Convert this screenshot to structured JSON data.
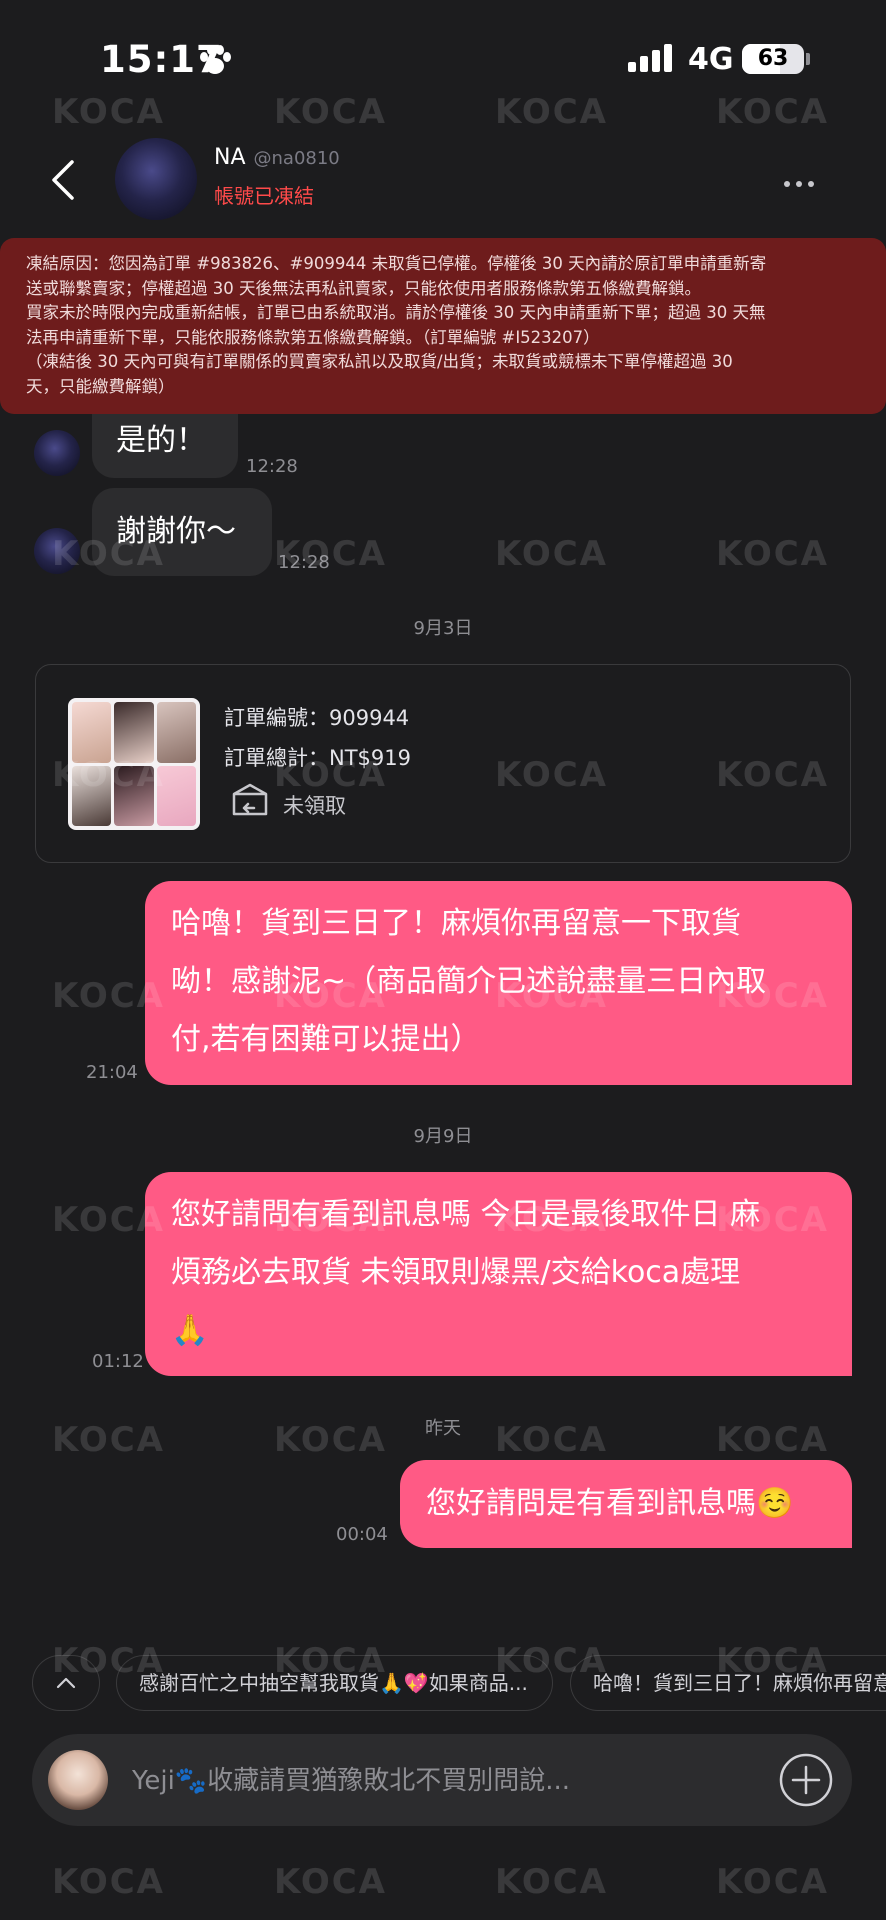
{
  "status_bar": {
    "time": "15:17",
    "network": "4G",
    "battery": "63"
  },
  "header": {
    "name": "NA",
    "handle": "@na0810",
    "status": "帳號已凍結"
  },
  "warning": {
    "lines": [
      "凍結原因：您因為訂單 #983826、#909944 未取貨已停權。停權後 30 天內請於原訂單申請重新寄",
      "送或聯繫賣家；停權超過 30 天後無法再私訊賣家，只能依使用者服務條款第五條繳費解鎖。",
      "買家未於時限內完成重新結帳，訂單已由系統取消。請於停權後 30 天內申請重新下單；超過 30 天無",
      "法再申請重新下單，只能依服務條款第五條繳費解鎖。（訂單編號 #I523207）",
      "（凍結後 30 天內可與有訂單關係的買賣家私訊以及取貨/出貨；未取貨或競標未下單停權超過 30",
      "天，只能繳費解鎖）"
    ]
  },
  "messages_in": [
    {
      "text": "是的！",
      "time": "12:28"
    },
    {
      "text": "謝謝你〜",
      "time": "12:28"
    }
  ],
  "date_separators": [
    "9月3日",
    "9月9日",
    "昨天"
  ],
  "order": {
    "number": "訂單編號：909944",
    "total": "訂單總計：NT$919",
    "status": "未領取"
  },
  "messages_out": [
    {
      "lines": [
        "哈嚕！貨到三日了！麻煩你再留意一下取貨",
        "呦！感謝泥~（商品簡介已述說盡量三日內取",
        "付,若有困難可以提出）"
      ],
      "time": "21:04"
    },
    {
      "lines": [
        "您好請問有看到訊息嗎 今日是最後取件日 麻",
        "煩務必去取貨 未領取則爆黑/交給koca處理",
        "🙏"
      ],
      "time": "01:12"
    },
    {
      "lines": [
        "您好請問是有看到訊息嗎☺️"
      ],
      "time": "00:04"
    }
  ],
  "quick_replies": [
    "感謝百忙之中抽空幫我取貨🙏💖如果商品...",
    "哈嚕！貨到三日了！麻煩你再留意"
  ],
  "composer": {
    "placeholder": "Yeji🐾收藏請買猶豫敗北不買別問說..."
  },
  "watermark": "KOCA"
}
